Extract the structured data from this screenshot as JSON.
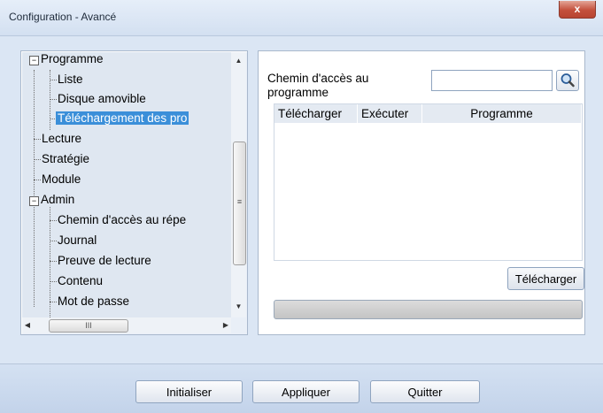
{
  "window": {
    "title": "Configuration - Avancé",
    "close_glyph": "x"
  },
  "tree": {
    "items": [
      {
        "label": "Programme",
        "expander": "−"
      },
      {
        "label": "Liste"
      },
      {
        "label": "Disque amovible"
      },
      {
        "label": "Téléchargement des pro",
        "selected": true
      },
      {
        "label": "Lecture"
      },
      {
        "label": "Stratégie"
      },
      {
        "label": "Module"
      },
      {
        "label": "Admin",
        "expander": "−"
      },
      {
        "label": "Chemin d'accès au répe"
      },
      {
        "label": "Journal"
      },
      {
        "label": "Preuve de lecture"
      },
      {
        "label": "Contenu"
      },
      {
        "label": "Mot de passe"
      }
    ],
    "selection_color": "#3b8fd9"
  },
  "panel": {
    "path_label_line1": "Chemin d'accès au",
    "path_label_line2": "programme",
    "path_value": "",
    "search_icon": "magnifier-icon",
    "columns": [
      "Télécharger",
      "Exécuter",
      "Programme"
    ],
    "rows": [],
    "download_label": "Télécharger",
    "progress": 0
  },
  "footer": {
    "init_label": "Initialiser",
    "apply_label": "Appliquer",
    "quit_label": "Quitter"
  }
}
